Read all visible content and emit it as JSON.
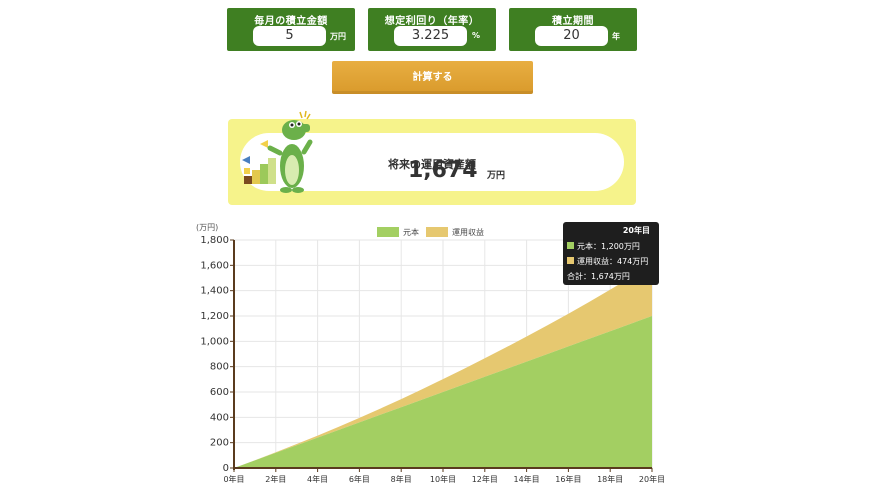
{
  "inputs": [
    {
      "label": "毎月の積立金額",
      "value": "5",
      "unit": "万円"
    },
    {
      "label": "想定利回り（年率）",
      "value": "3.225",
      "unit": "%"
    },
    {
      "label": "積立期間",
      "value": "20",
      "unit": "年"
    }
  ],
  "calc_button": "計算する",
  "result": {
    "label": "将来の運用資産額",
    "value": "1,674",
    "unit": "万円"
  },
  "colors": {
    "header_green": "#3f7f22",
    "button_orange": "#dea035",
    "panel_yellow": "#f6f38b",
    "principal": "#a3cf62",
    "earnings": "#e6c870",
    "axis": "#5a3b1e"
  },
  "chart_data": {
    "type": "area",
    "stacked": true,
    "y_unit_label": "(万円)",
    "ylim": [
      0,
      1800
    ],
    "y_ticks": [
      "0",
      "200",
      "400",
      "600",
      "800",
      "1,000",
      "1,200",
      "1,400",
      "1,600",
      "1,800"
    ],
    "x_ticks": [
      "0年目",
      "2年目",
      "4年目",
      "6年目",
      "8年目",
      "10年目",
      "12年目",
      "14年目",
      "16年目",
      "18年目",
      "20年目"
    ],
    "x": [
      0,
      1,
      2,
      3,
      4,
      5,
      6,
      7,
      8,
      9,
      10,
      11,
      12,
      13,
      14,
      15,
      16,
      17,
      18,
      19,
      20
    ],
    "series": [
      {
        "name": "元本",
        "values": [
          0,
          60,
          120,
          180,
          240,
          300,
          360,
          420,
          480,
          540,
          600,
          660,
          720,
          780,
          840,
          900,
          960,
          1020,
          1080,
          1140,
          1200
        ]
      },
      {
        "name": "運用収益",
        "values": [
          0,
          1,
          4,
          9,
          16,
          25,
          36,
          49,
          64,
          82,
          102,
          123,
          146,
          171,
          198,
          227,
          258,
          292,
          328,
          366,
          474
        ]
      }
    ],
    "legend": "top-center",
    "grid": true,
    "tooltip": {
      "title": "20年目",
      "lines": [
        "元本：1,200万円",
        "運用収益：474万円",
        "合計：1,674万円"
      ]
    }
  }
}
